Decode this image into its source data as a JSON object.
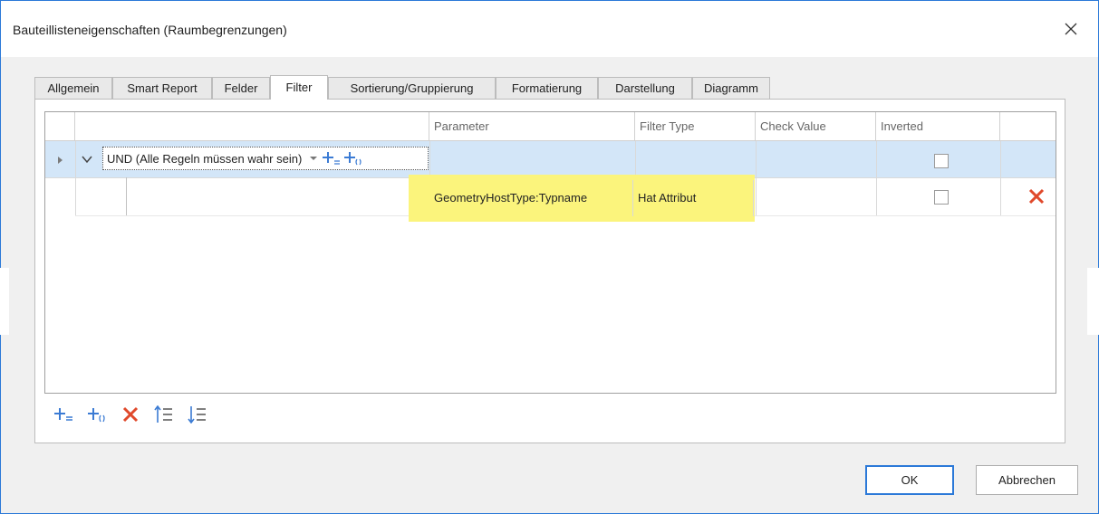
{
  "window": {
    "title": "Bauteillisteneigenschaften (Raumbegrenzungen)",
    "close_icon": "close-icon"
  },
  "tabs": [
    {
      "label": "Allgemein"
    },
    {
      "label": "Smart Report"
    },
    {
      "label": "Felder"
    },
    {
      "label": "Filter",
      "active": true
    },
    {
      "label": "Sortierung/Gruppierung"
    },
    {
      "label": "Formatierung"
    },
    {
      "label": "Darstellung"
    },
    {
      "label": "Diagramm"
    }
  ],
  "grid": {
    "columns": [
      "",
      "Parameter",
      "Filter Type",
      "Check Value",
      "Inverted",
      ""
    ],
    "group_row": {
      "label": "UND (Alle Regeln müssen wahr sein)",
      "inverted": false
    },
    "rule_row": {
      "parameter": "GeometryHostType:Typname",
      "filter_type": "Hat Attribut",
      "check_value": "",
      "inverted": false
    }
  },
  "toolbar": {
    "icons": [
      "add-condition-icon",
      "add-group-icon",
      "delete-icon",
      "move-up-icon",
      "move-down-icon"
    ]
  },
  "buttons": {
    "ok": "OK",
    "cancel": "Abbrechen"
  },
  "colors": {
    "accent": "#2b79d8",
    "plus_icon": "#3b7bd4",
    "delete": "#e0492b",
    "highlight": "#fbf47c",
    "selected_row": "#d3e6f8"
  }
}
